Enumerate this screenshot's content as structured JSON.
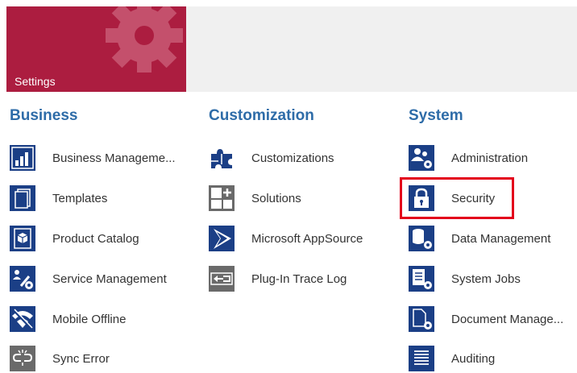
{
  "tile": {
    "label": "Settings",
    "icon": "gear-icon"
  },
  "columns": [
    {
      "header": "Business",
      "items": [
        {
          "label": "Business Manageme...",
          "icon": "chart-icon"
        },
        {
          "label": "Templates",
          "icon": "document-icon"
        },
        {
          "label": "Product Catalog",
          "icon": "cube-icon"
        },
        {
          "label": "Service Management",
          "icon": "wrench-person-icon"
        },
        {
          "label": "Mobile Offline",
          "icon": "offline-icon"
        },
        {
          "label": "Sync Error",
          "icon": "broken-link-icon"
        }
      ]
    },
    {
      "header": "Customization",
      "items": [
        {
          "label": "Customizations",
          "icon": "puzzle-icon"
        },
        {
          "label": "Solutions",
          "icon": "solution-icon"
        },
        {
          "label": "Microsoft AppSource",
          "icon": "appsource-icon"
        },
        {
          "label": "Plug-In Trace Log",
          "icon": "trace-log-icon"
        }
      ]
    },
    {
      "header": "System",
      "items": [
        {
          "label": "Administration",
          "icon": "users-gear-icon"
        },
        {
          "label": "Security",
          "icon": "lock-icon"
        },
        {
          "label": "Data Management",
          "icon": "database-gear-icon"
        },
        {
          "label": "System Jobs",
          "icon": "jobs-gear-icon"
        },
        {
          "label": "Document Manage...",
          "icon": "document-gear-icon"
        },
        {
          "label": "Auditing",
          "icon": "list-icon"
        }
      ]
    }
  ],
  "colors": {
    "tile": "#ac1d40",
    "header": "#2e6ca8",
    "icon_blue": "#1b3f86",
    "icon_gray": "#6a6a6a",
    "highlight": "#e3001b"
  }
}
